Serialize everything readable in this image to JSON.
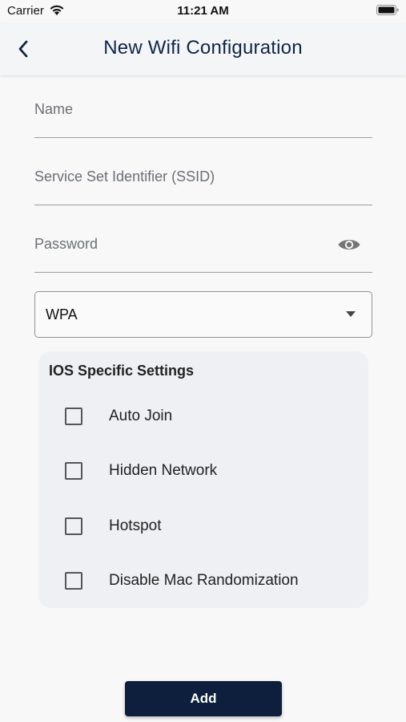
{
  "status_bar": {
    "carrier": "Carrier",
    "time": "11:21 AM",
    "icons": [
      "wifi-icon",
      "battery-icon"
    ]
  },
  "header": {
    "title": "New Wifi Configuration",
    "back_icon": "chevron-left-icon",
    "title_color": "#0f2547"
  },
  "form": {
    "name_placeholder": "Name",
    "ssid_placeholder": "Service Set Identifier (SSID)",
    "password_placeholder": "Password",
    "password_toggle_icon": "eye-icon",
    "security": {
      "selected": "WPA",
      "icon": "caret-down-icon"
    }
  },
  "ios_settings": {
    "title": "IOS Specific Settings",
    "items": [
      {
        "label": "Auto Join",
        "checked": false
      },
      {
        "label": "Hidden Network",
        "checked": false
      },
      {
        "label": "Hotspot",
        "checked": false
      },
      {
        "label": "Disable Mac Randomization",
        "checked": false
      }
    ]
  },
  "actions": {
    "add_label": "Add",
    "add_color": "#0d1f3c"
  }
}
